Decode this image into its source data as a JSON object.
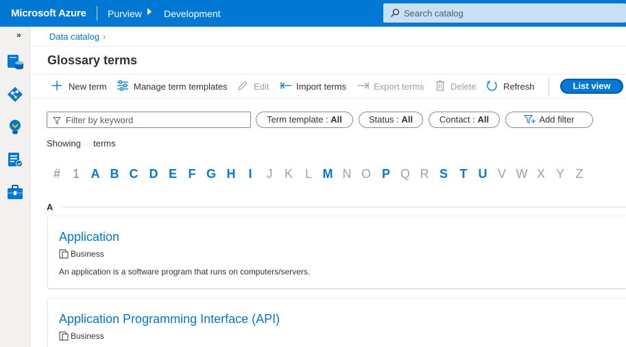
{
  "topbar": {
    "brand": "Microsoft Azure",
    "service": "Purview",
    "account": "Development",
    "search_placeholder": "Search catalog"
  },
  "rail": {
    "expand": "»",
    "icons": [
      "data-catalog-icon",
      "data-map-icon",
      "insights-icon",
      "policy-icon",
      "management-icon"
    ]
  },
  "breadcrumb": {
    "item": "Data catalog",
    "chevron": "›"
  },
  "page": {
    "title": "Glossary terms"
  },
  "commands": {
    "new_term": "New term",
    "manage_templates": "Manage term templates",
    "edit": "Edit",
    "import": "Import terms",
    "export": "Export terms",
    "delete": "Delete",
    "refresh": "Refresh",
    "list_view": "List view"
  },
  "filters": {
    "keyword_placeholder": "Filter by keyword",
    "term_template_label": "Term template : ",
    "term_template_value": "All",
    "status_label": "Status : ",
    "status_value": "All",
    "contact_label": "Contact : ",
    "contact_value": "All",
    "add_filter": "Add filter"
  },
  "results": {
    "showing_prefix": "Showing",
    "showing_suffix": "terms"
  },
  "alphabet": {
    "hash": "#",
    "one": "1",
    "A": "A",
    "B": "B",
    "C": "C",
    "D": "D",
    "E": "E",
    "F": "F",
    "G": "G",
    "H": "H",
    "I": "I",
    "J": "J",
    "K": "K",
    "L": "L",
    "M": "M",
    "N": "N",
    "O": "O",
    "P": "P",
    "Q": "Q",
    "R": "R",
    "S": "S",
    "T": "T",
    "U": "U",
    "V": "V",
    "W": "W",
    "X": "X",
    "Y": "Y",
    "Z": "Z"
  },
  "section": {
    "letter": "A"
  },
  "terms": [
    {
      "name": "Application",
      "template": "Business",
      "description": "An application is a software program that runs on computers/servers."
    },
    {
      "name": "Application Programming Interface (API)",
      "template": "Business"
    }
  ],
  "colors": {
    "accent": "#0078d4",
    "search_bg": "#c7e0f4",
    "disabled": "#a19f9d"
  }
}
